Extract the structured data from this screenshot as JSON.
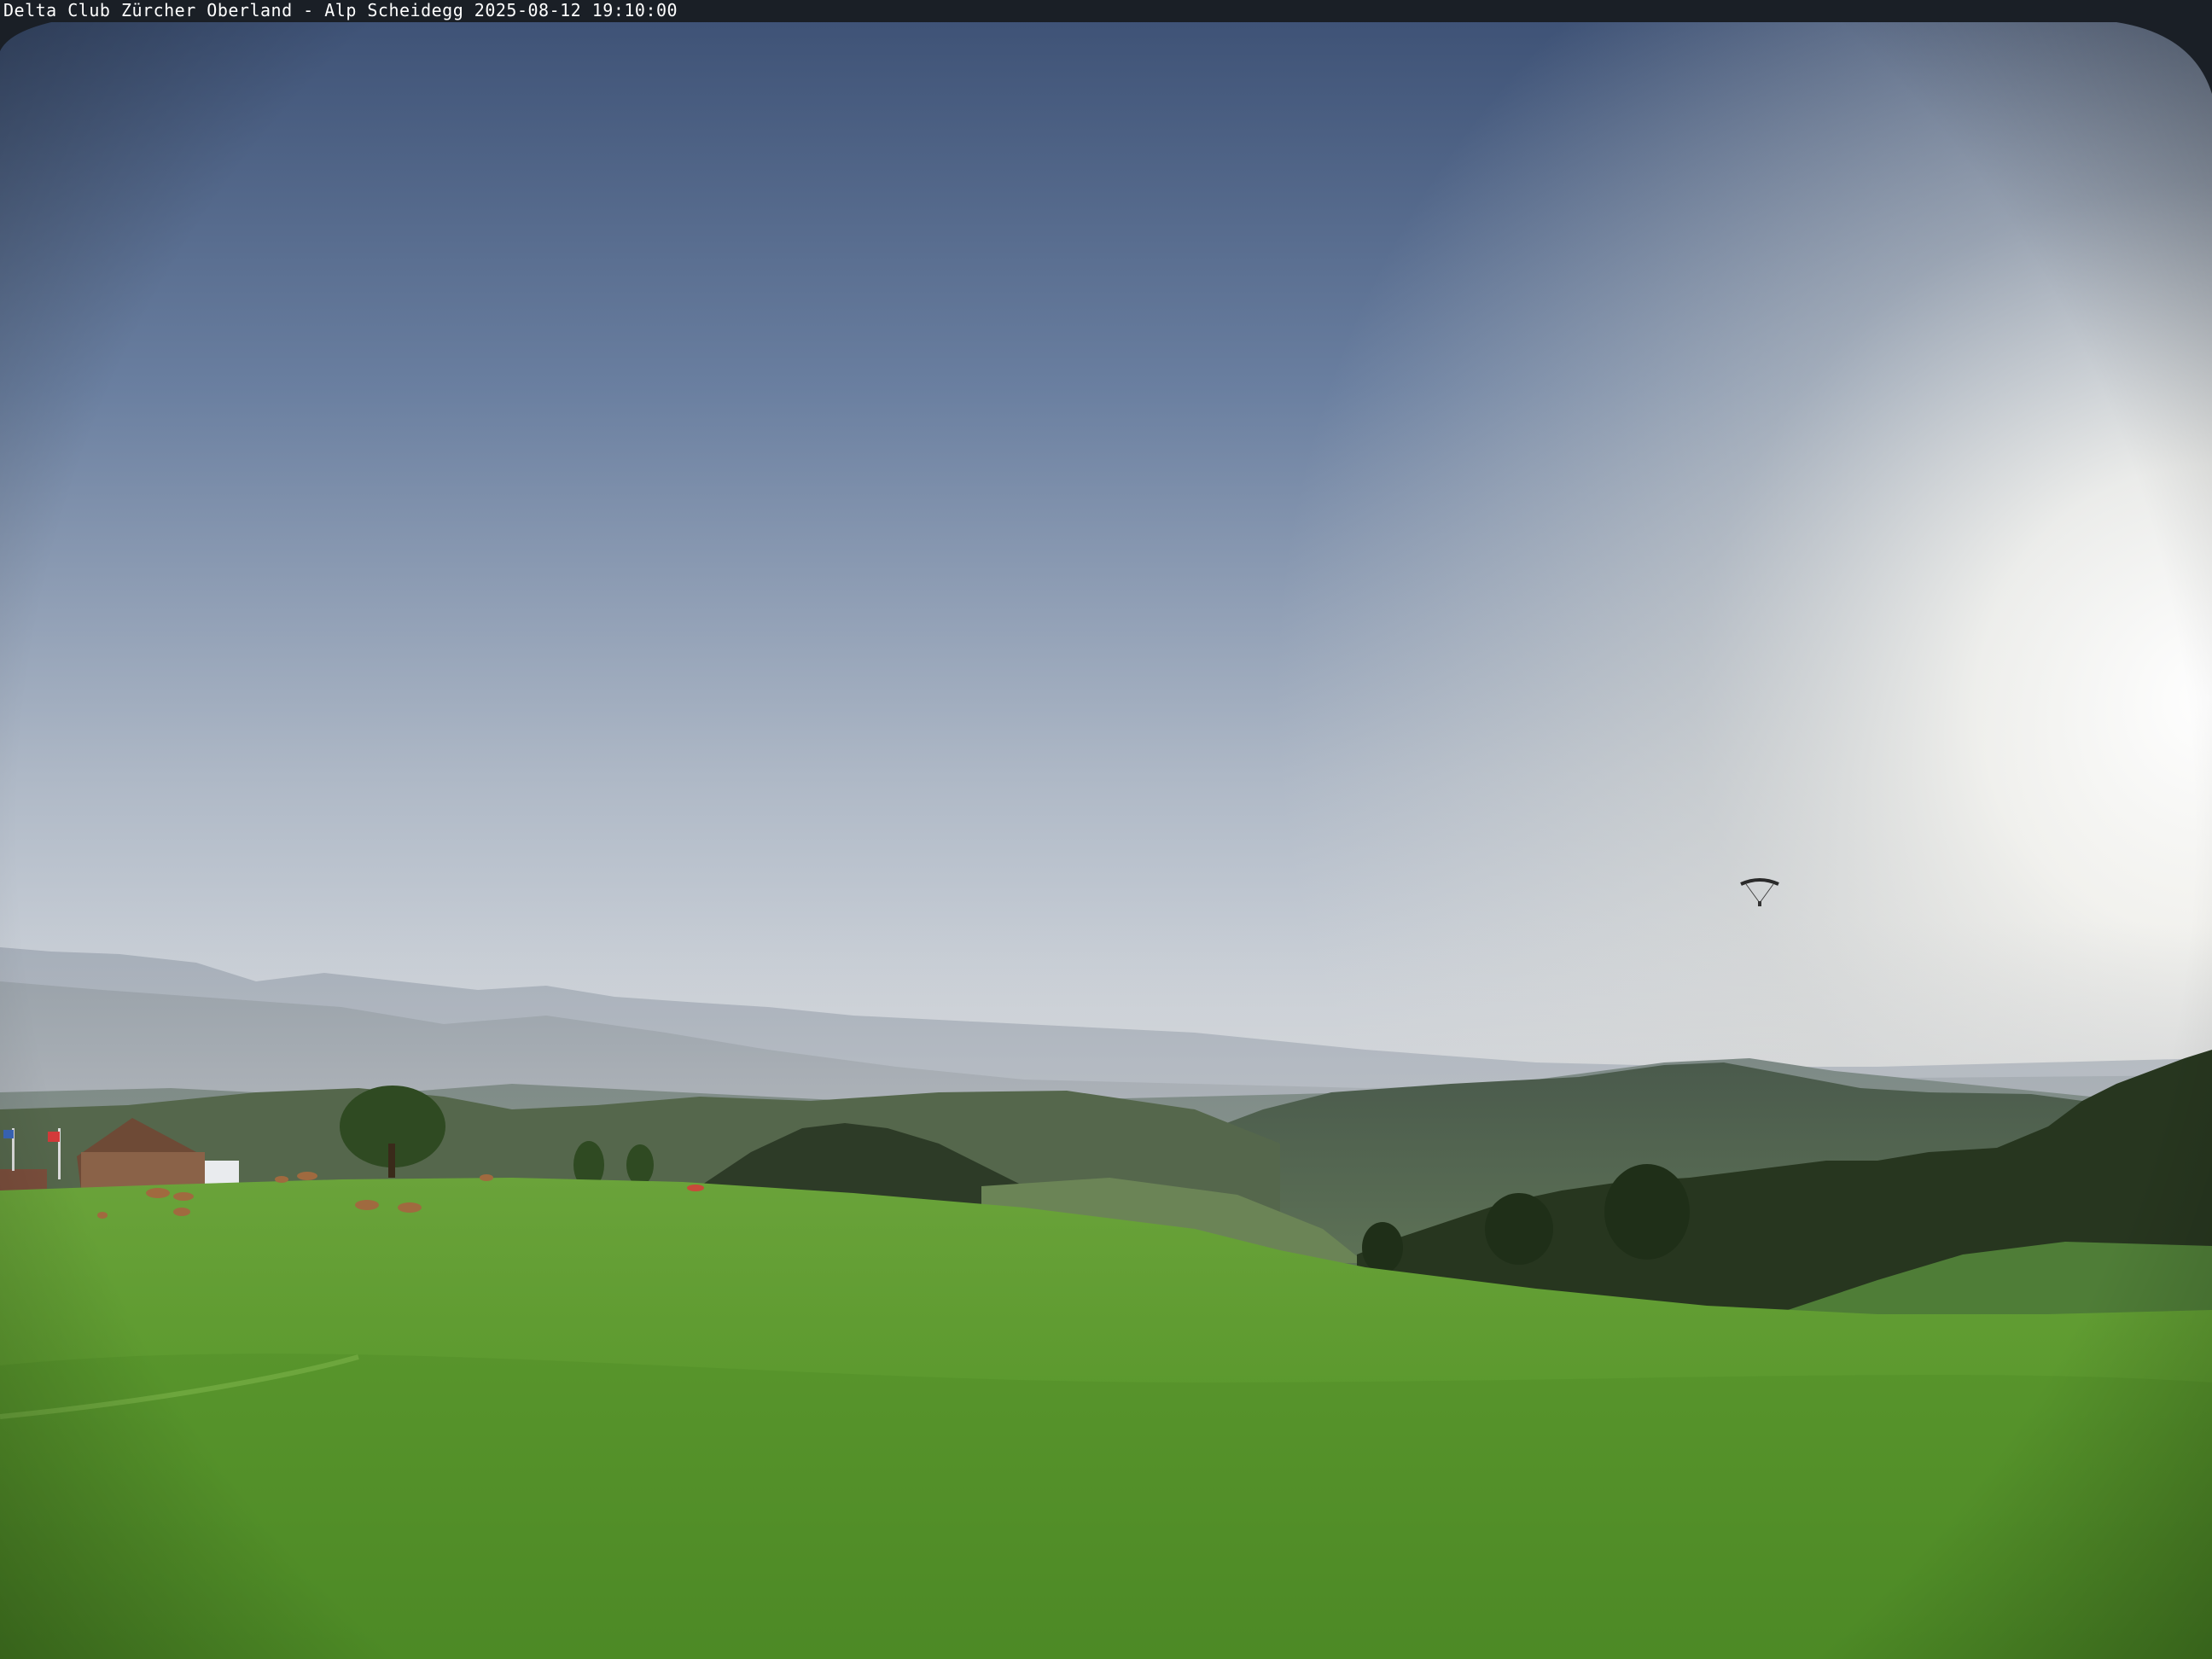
{
  "caption": {
    "text": "Delta Club Zürcher Oberland - Alp Scheidegg 2025-08-12 19:10:00"
  },
  "scene": {
    "sky_top_color": "#3f5478",
    "sky_horizon_color": "#dfe3e6",
    "sun_glow_color": "#ffffff",
    "meadow_color": "#5d9a2f",
    "forest_color": "#2c3a25",
    "haze_mountain_color": "#9aa4b0",
    "icons": [
      "paraglider-icon",
      "farmhouse-icon",
      "flag-icon",
      "cow-icon",
      "tree-icon"
    ]
  }
}
